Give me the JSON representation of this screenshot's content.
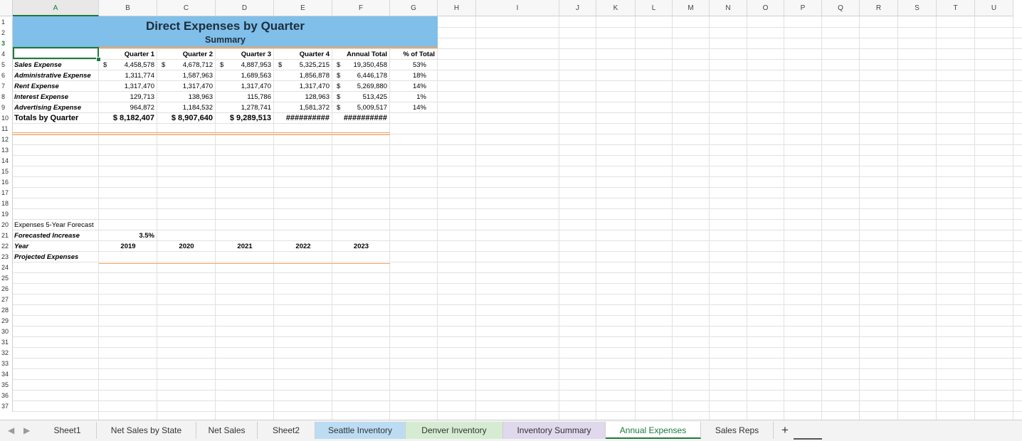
{
  "columns": [
    "A",
    "B",
    "C",
    "D",
    "E",
    "F",
    "G",
    "H",
    "I",
    "J",
    "K",
    "L",
    "M",
    "N",
    "O",
    "P",
    "Q",
    "R",
    "S",
    "T",
    "U"
  ],
  "rows": [
    "1",
    "2",
    "3",
    "4",
    "5",
    "6",
    "7",
    "8",
    "9",
    "10",
    "11",
    "12",
    "13",
    "14",
    "15",
    "16",
    "17",
    "18",
    "19",
    "20",
    "21",
    "22",
    "23",
    "24",
    "25",
    "26",
    "27",
    "28",
    "29",
    "30",
    "31",
    "32",
    "33",
    "34",
    "35",
    "36",
    "37"
  ],
  "sheet": {
    "title": "Direct Expenses by Quarter",
    "subtitle": "Summary",
    "headers": [
      "Quarter 1",
      "Quarter 2",
      "Quarter 3",
      "Quarter 4",
      "Annual Total",
      "% of Total"
    ],
    "dollar": "$",
    "expenses": [
      {
        "label": "Sales Expense",
        "q1": "4,458,578",
        "q2": "4,678,712",
        "q3": "4,887,953",
        "q4": "5,325,215",
        "total": "19,350,458",
        "pct": "53%",
        "dollars": true
      },
      {
        "label": "Administrative Expense",
        "q1": "1,311,774",
        "q2": "1,587,963",
        "q3": "1,689,563",
        "q4": "1,856,878",
        "total": "6,446,178",
        "pct": "18%",
        "dollars": false
      },
      {
        "label": "Rent Expense",
        "q1": "1,317,470",
        "q2": "1,317,470",
        "q3": "1,317,470",
        "q4": "1,317,470",
        "total": "5,269,880",
        "pct": "14%",
        "dollars": false
      },
      {
        "label": "Interest Expense",
        "q1": "129,713",
        "q2": "138,963",
        "q3": "115,786",
        "q4": "128,963",
        "total": "513,425",
        "pct": "1%",
        "dollars": false
      },
      {
        "label": "Advertising Expense",
        "q1": "964,872",
        "q2": "1,184,532",
        "q3": "1,278,741",
        "q4": "1,581,372",
        "total": "5,009,517",
        "pct": "14%",
        "dollars": false
      }
    ],
    "totals": {
      "label": "Totals by Quarter",
      "q1": "$ 8,182,407",
      "q2": "$ 8,907,640",
      "q3": "$ 9,289,513",
      "q4": "##########",
      "total": "##########"
    },
    "forecast": {
      "title": "Expenses 5-Year Forecast",
      "increase_label": "Forecasted Increase",
      "increase_value": "3.5%",
      "year_label": "Year",
      "years": [
        "2019",
        "2020",
        "2021",
        "2022",
        "2023"
      ],
      "projected_label": "Projected Expenses"
    }
  },
  "tabs": [
    {
      "label": "Sheet1",
      "color": ""
    },
    {
      "label": "Net Sales by State",
      "color": ""
    },
    {
      "label": "Net Sales",
      "color": ""
    },
    {
      "label": "Sheet2",
      "color": ""
    },
    {
      "label": "Seattle Inventory",
      "color": "#bcdcf3"
    },
    {
      "label": "Denver Inventory",
      "color": "#d6ecd2"
    },
    {
      "label": "Inventory Summary",
      "color": "#e0d8ec"
    },
    {
      "label": "Annual Expenses",
      "color": "#ffffff"
    },
    {
      "label": "Sales Reps",
      "color": ""
    }
  ],
  "active_tab": "Annual Expenses",
  "add_sheet": "+",
  "nav": {
    "prev": "◀",
    "next": "▶"
  },
  "colors": {
    "accent": "#1d7a3a",
    "title_band": "#7fbfe9",
    "orange": "#f4a259"
  }
}
